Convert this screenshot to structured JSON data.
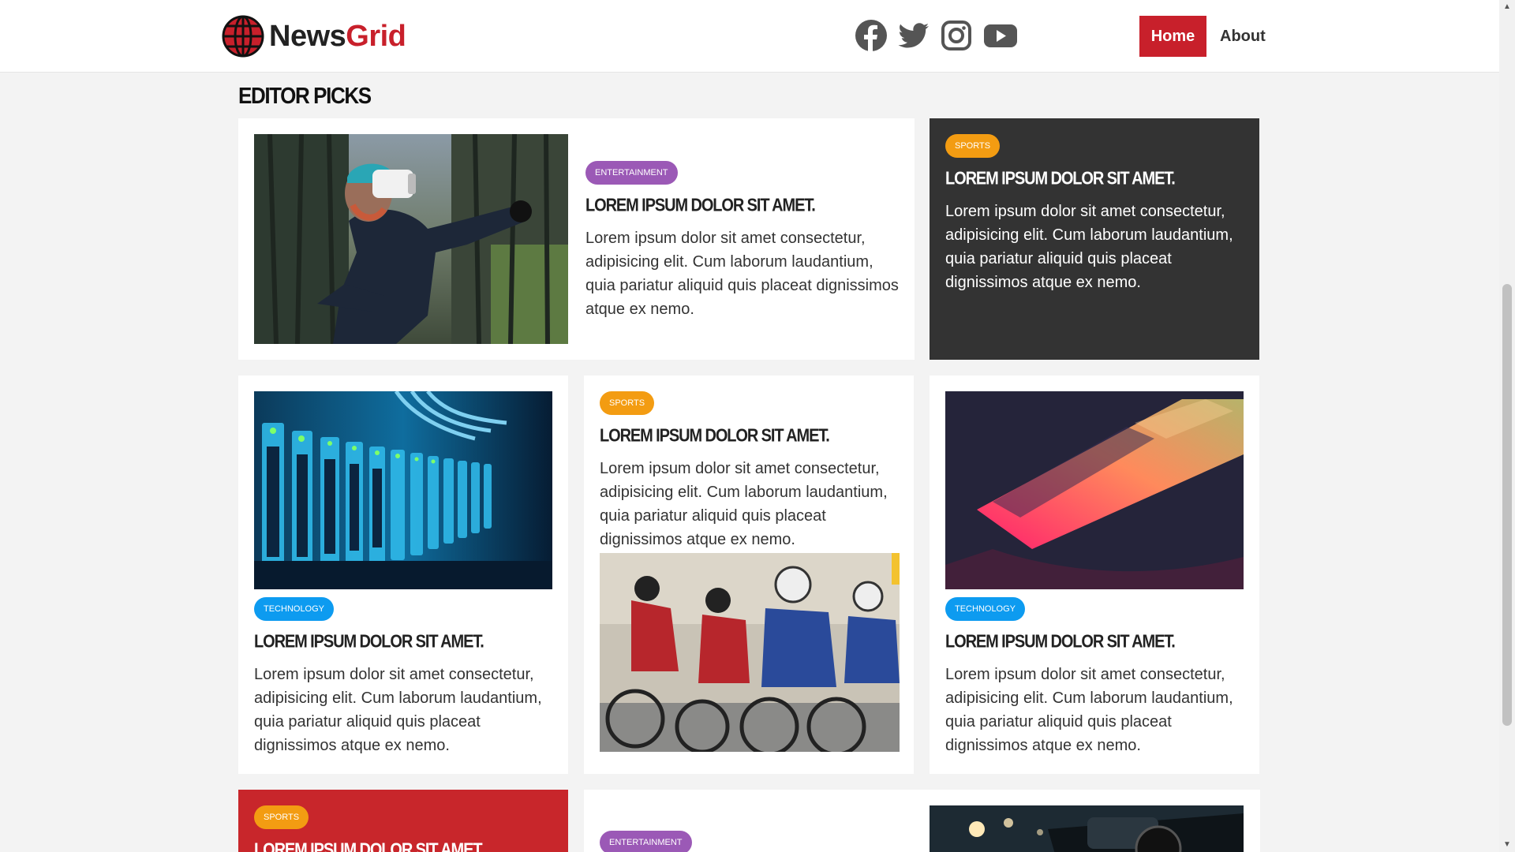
{
  "header": {
    "logo_part1": "News",
    "logo_part2": "Grid",
    "socials": [
      "facebook-icon",
      "twitter-icon",
      "instagram-icon",
      "youtube-icon"
    ],
    "nav": {
      "home": "Home",
      "about": "About"
    }
  },
  "section_title": "EDITOR PICKS",
  "cards": [
    {
      "badge": "ENTERTAINMENT",
      "title": "LOREM IPSUM DOLOR SIT AMET.",
      "body": "Lorem ipsum dolor sit amet consectetur, adipisicing elit. Cum laborum laudantium, quia pariatur aliquid quis placeat dignissimos atque ex nemo."
    },
    {
      "badge": "SPORTS",
      "title": "LOREM IPSUM DOLOR SIT AMET.",
      "body": "Lorem ipsum dolor sit amet consectetur, adipisicing elit. Cum laborum laudantium, quia pariatur aliquid quis placeat dignissimos atque ex nemo."
    },
    {
      "badge": "TECHNOLOGY",
      "title": "LOREM IPSUM DOLOR SIT AMET.",
      "body": "Lorem ipsum dolor sit amet consectetur, adipisicing elit. Cum laborum laudantium, quia pariatur aliquid quis placeat dignissimos atque ex nemo."
    },
    {
      "badge": "SPORTS",
      "title": "LOREM IPSUM DOLOR SIT AMET.",
      "body": "Lorem ipsum dolor sit amet consectetur, adipisicing elit. Cum laborum laudantium, quia pariatur aliquid quis placeat dignissimos atque ex nemo."
    },
    {
      "badge": "TECHNOLOGY",
      "title": "LOREM IPSUM DOLOR SIT AMET.",
      "body": "Lorem ipsum dolor sit amet consectetur, adipisicing elit. Cum laborum laudantium, quia pariatur aliquid quis placeat dignissimos atque ex nemo."
    },
    {
      "badge": "SPORTS",
      "title": "LOREM IPSUM DOLOR SIT AMET."
    },
    {
      "badge": "ENTERTAINMENT"
    }
  ],
  "colors": {
    "brand_red": "#c8202b",
    "sports": "#f39c12",
    "entertainment": "#9b59b6",
    "technology": "#0d9bf0",
    "dark_card": "#333333"
  }
}
